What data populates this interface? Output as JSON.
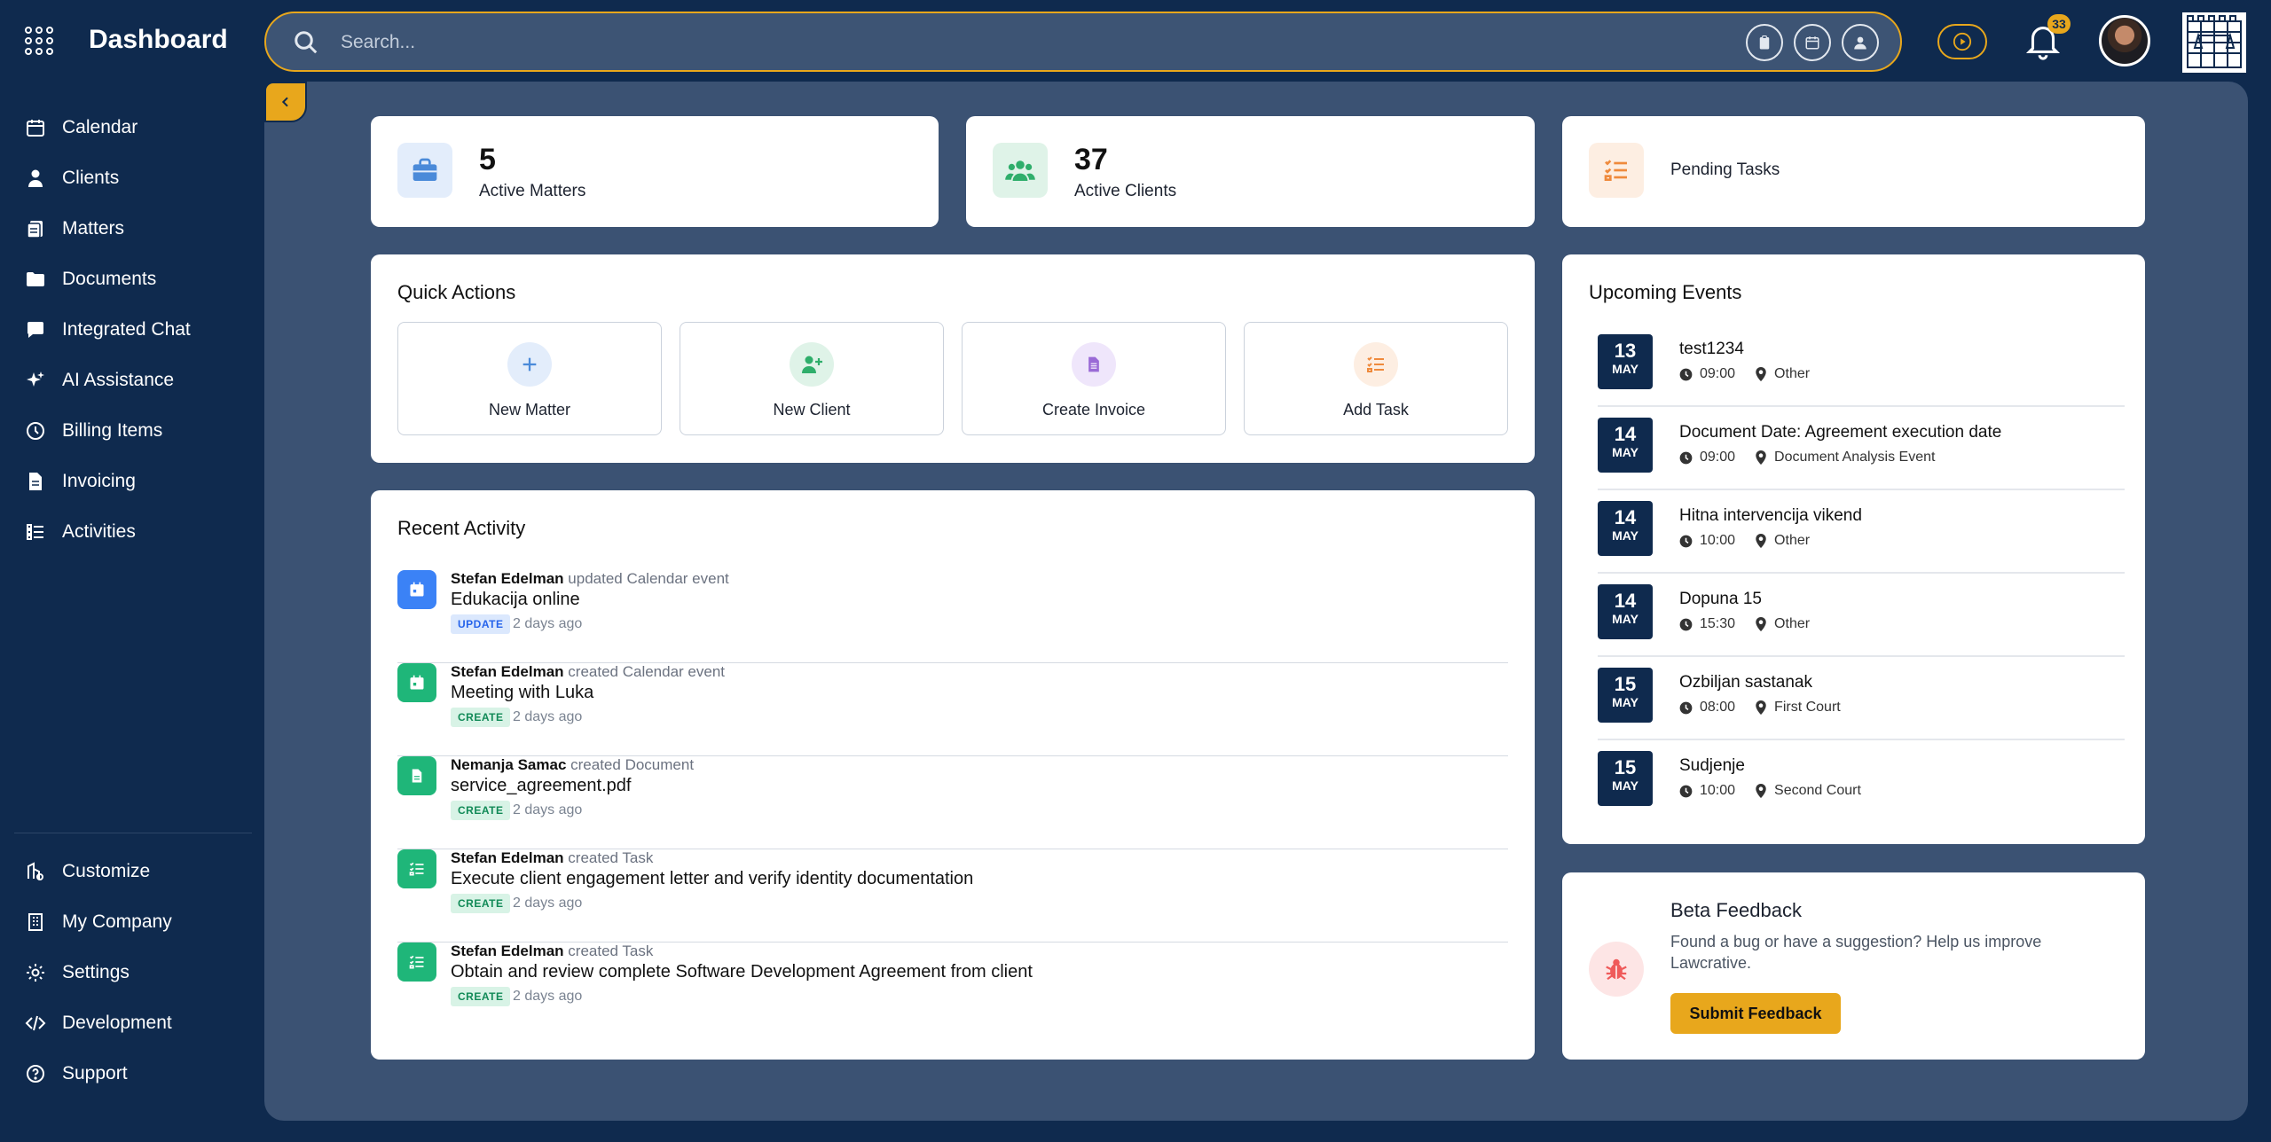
{
  "app": {
    "title": "Dashboard"
  },
  "search": {
    "placeholder": "Search..."
  },
  "header": {
    "notification_count": "33"
  },
  "sidebar": {
    "items": [
      {
        "label": "Calendar",
        "icon": "calendar-icon"
      },
      {
        "label": "Clients",
        "icon": "user-icon"
      },
      {
        "label": "Matters",
        "icon": "matters-icon"
      },
      {
        "label": "Documents",
        "icon": "folder-icon"
      },
      {
        "label": "Integrated Chat",
        "icon": "chat-icon"
      },
      {
        "label": "AI Assistance",
        "icon": "sparkle-icon"
      },
      {
        "label": "Billing Items",
        "icon": "clock-icon"
      },
      {
        "label": "Invoicing",
        "icon": "file-icon"
      },
      {
        "label": "Activities",
        "icon": "list-icon"
      }
    ],
    "bottom_items": [
      {
        "label": "Customize",
        "icon": "customize-icon"
      },
      {
        "label": "My Company",
        "icon": "building-icon"
      },
      {
        "label": "Settings",
        "icon": "gear-icon"
      },
      {
        "label": "Development",
        "icon": "code-icon"
      },
      {
        "label": "Support",
        "icon": "help-icon"
      }
    ]
  },
  "stats": {
    "matters": {
      "value": "5",
      "label": "Active Matters"
    },
    "clients": {
      "value": "37",
      "label": "Active Clients"
    },
    "tasks": {
      "label": "Pending Tasks"
    }
  },
  "quick_actions": {
    "title": "Quick Actions",
    "items": [
      {
        "label": "New Matter"
      },
      {
        "label": "New Client"
      },
      {
        "label": "Create Invoice"
      },
      {
        "label": "Add Task"
      }
    ]
  },
  "recent_activity": {
    "title": "Recent Activity",
    "items": [
      {
        "user": "Stefan Edelman",
        "action": "updated Calendar event",
        "title": "Edukacija online",
        "badge": "UPDATE",
        "time": "2 days ago"
      },
      {
        "user": "Stefan Edelman",
        "action": "created Calendar event",
        "title": "Meeting with Luka",
        "badge": "CREATE",
        "time": "2 days ago"
      },
      {
        "user": "Nemanja Samac",
        "action": "created Document",
        "title": "service_agreement.pdf",
        "badge": "CREATE",
        "time": "2 days ago"
      },
      {
        "user": "Stefan Edelman",
        "action": "created Task",
        "title": "Execute client engagement letter and verify identity documentation",
        "badge": "CREATE",
        "time": "2 days ago"
      },
      {
        "user": "Stefan Edelman",
        "action": "created Task",
        "title": "Obtain and review complete Software Development Agreement from client",
        "badge": "CREATE",
        "time": "2 days ago"
      }
    ]
  },
  "upcoming_events": {
    "title": "Upcoming Events",
    "items": [
      {
        "day": "13",
        "month": "MAY",
        "title": "test1234",
        "time": "09:00",
        "location": "Other"
      },
      {
        "day": "14",
        "month": "MAY",
        "title": "Document Date: Agreement execution date",
        "time": "09:00",
        "location": "Document Analysis Event"
      },
      {
        "day": "14",
        "month": "MAY",
        "title": "Hitna intervencija vikend",
        "time": "10:00",
        "location": "Other"
      },
      {
        "day": "14",
        "month": "MAY",
        "title": "Dopuna 15",
        "time": "15:30",
        "location": "Other"
      },
      {
        "day": "15",
        "month": "MAY",
        "title": "Ozbiljan sastanak",
        "time": "08:00",
        "location": "First Court"
      },
      {
        "day": "15",
        "month": "MAY",
        "title": "Sudjenje",
        "time": "10:00",
        "location": "Second Court"
      }
    ]
  },
  "feedback": {
    "title": "Beta Feedback",
    "text": "Found a bug or have a suggestion? Help us improve Lawcrative.",
    "button": "Submit Feedback"
  },
  "colors": {
    "navy": "#0f2a4e",
    "panel": "#3b5273",
    "accent": "#e8a71c"
  }
}
